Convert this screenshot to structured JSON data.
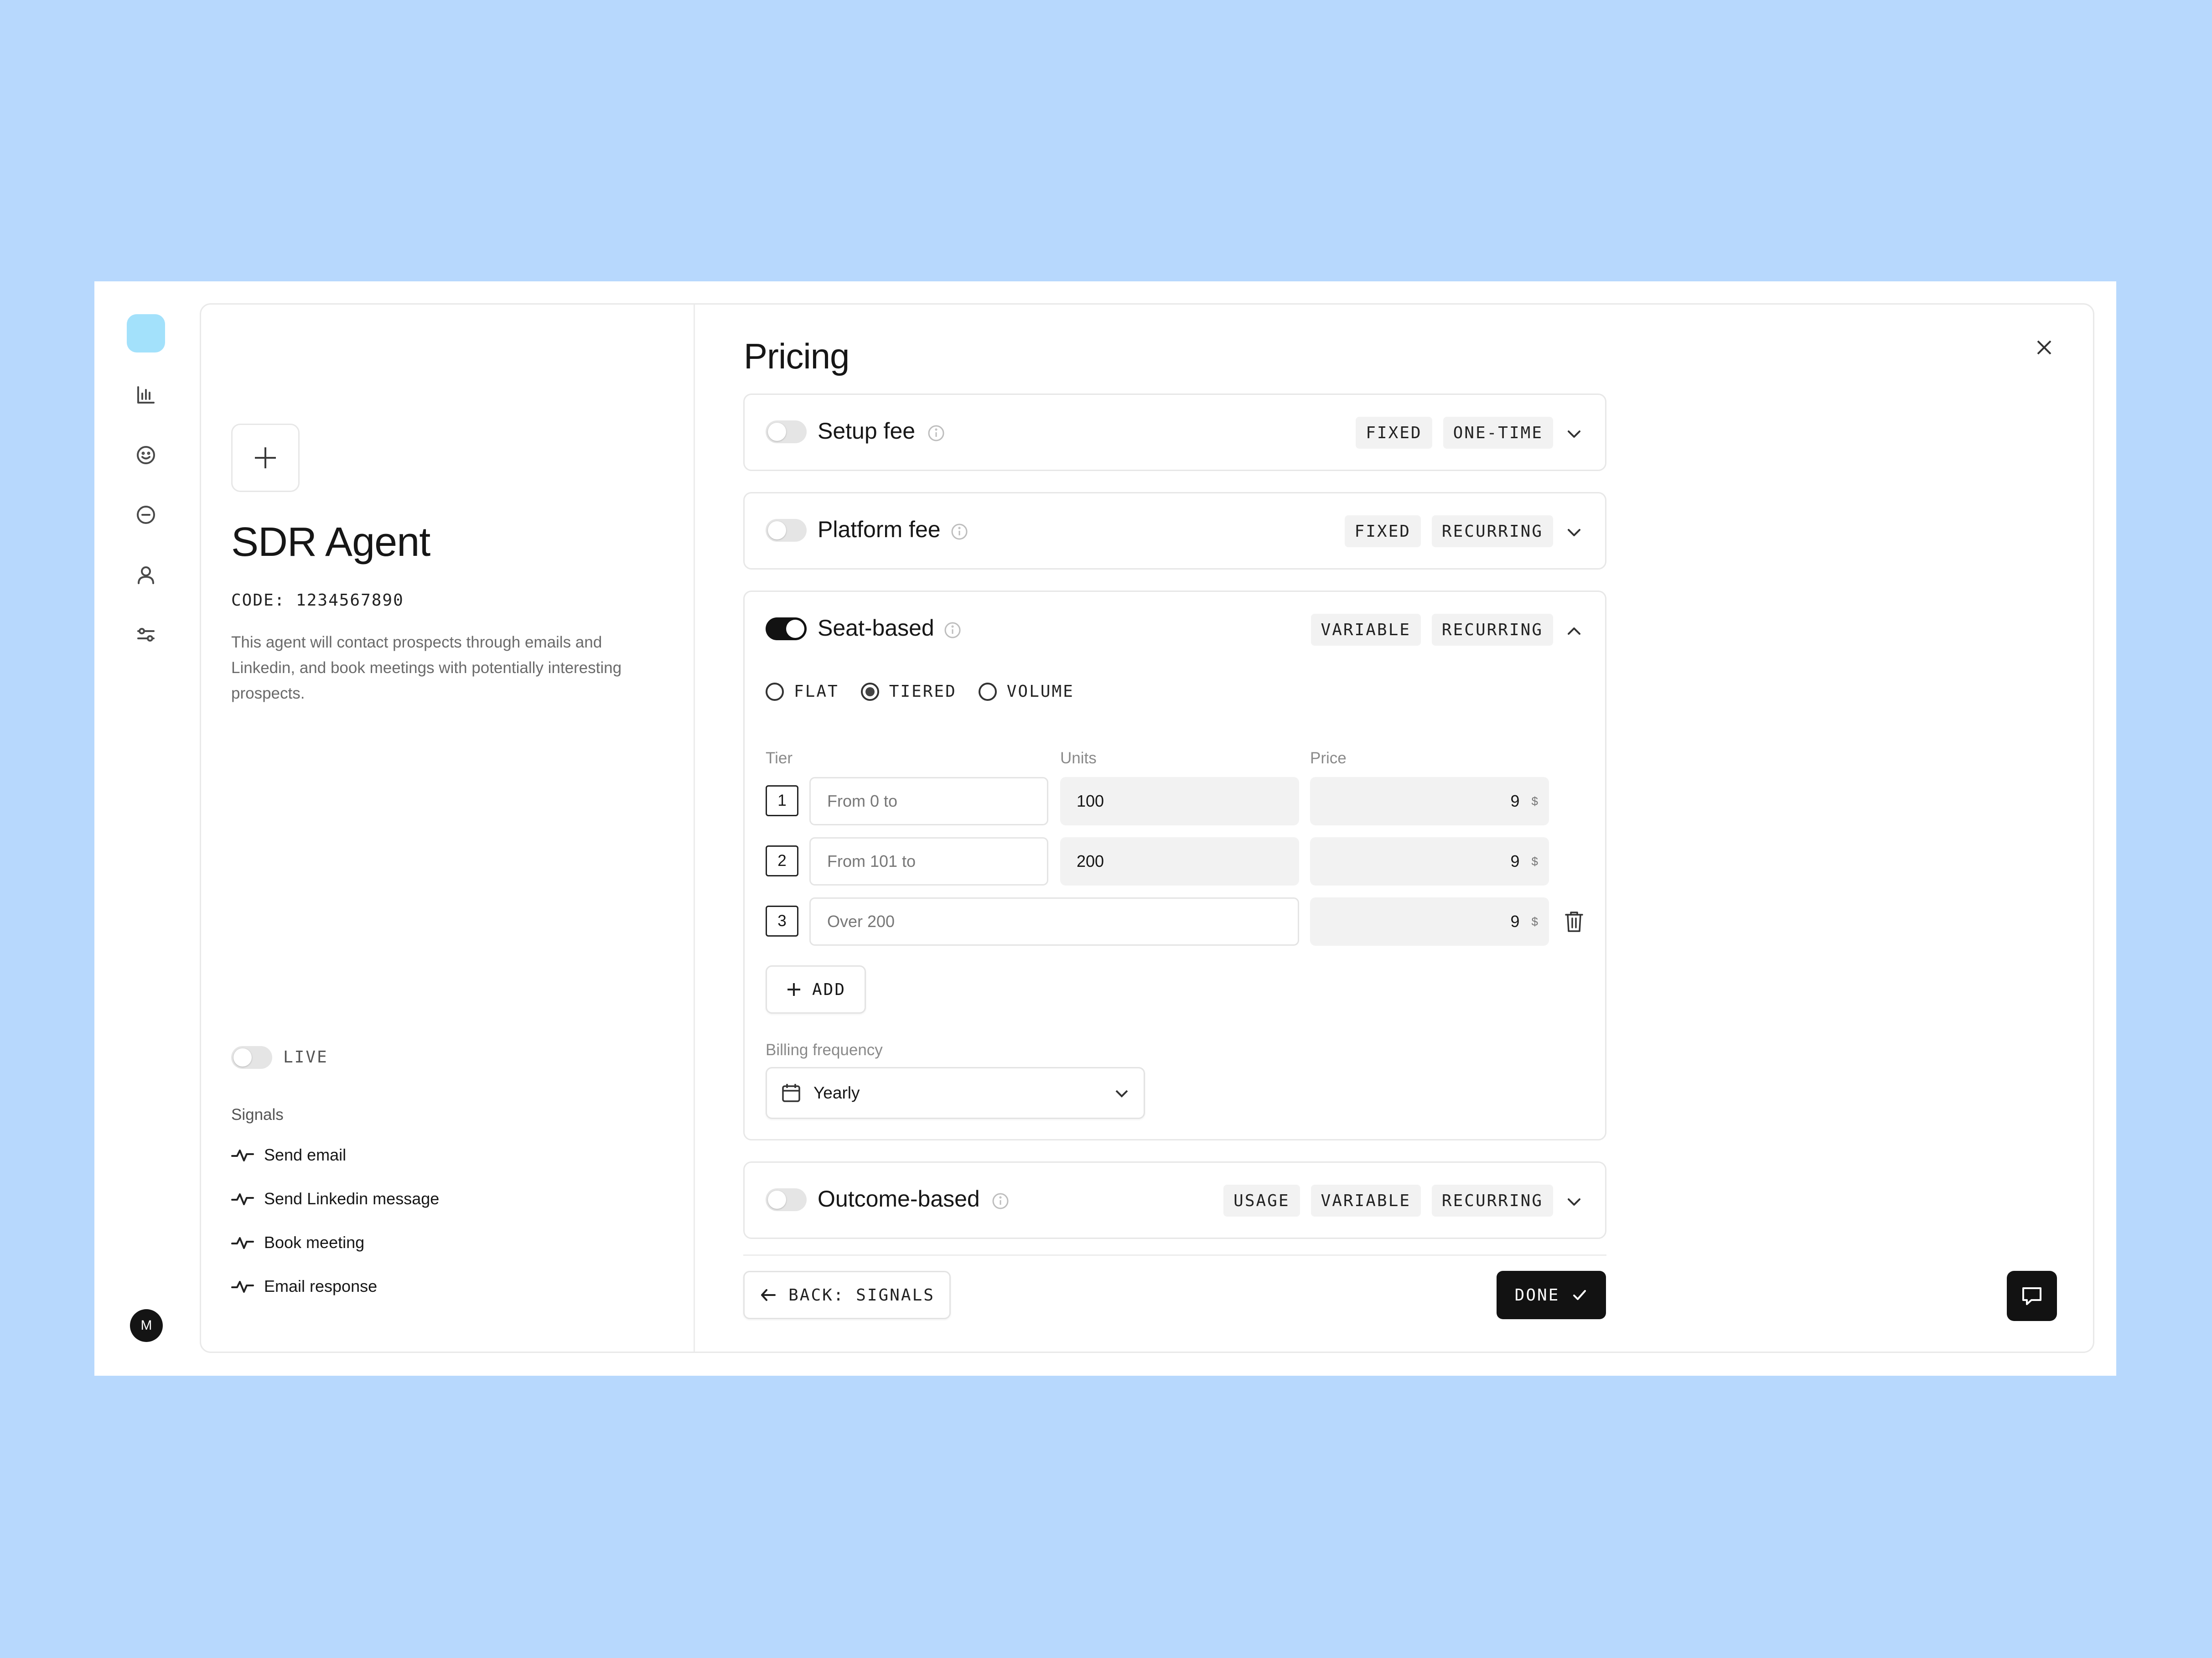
{
  "agent": {
    "title": "SDR Agent",
    "code": "CODE: 1234567890",
    "description": "This agent will contact prospects through emails and Linkedin, and book meetings with potentially interesting prospects.",
    "live_label": "LIVE",
    "live_on": false
  },
  "signals": {
    "title": "Signals",
    "items": [
      {
        "label": "Send email"
      },
      {
        "label": "Send Linkedin message"
      },
      {
        "label": "Book meeting"
      },
      {
        "label": "Email response"
      }
    ]
  },
  "sidebar": {
    "icons": [
      "chart-icon",
      "smiley-icon",
      "minus-circle-icon",
      "user-icon",
      "sliders-icon"
    ],
    "avatar_initial": "M"
  },
  "pricing": {
    "title": "Pricing",
    "sections": [
      {
        "name": "Setup fee",
        "enabled": false,
        "tags": [
          "FIXED",
          "ONE-TIME"
        ],
        "expanded": false
      },
      {
        "name": "Platform fee",
        "enabled": false,
        "tags": [
          "FIXED",
          "RECURRING"
        ],
        "expanded": false
      },
      {
        "name": "Seat-based",
        "enabled": true,
        "tags": [
          "VARIABLE",
          "RECURRING"
        ],
        "expanded": true
      },
      {
        "name": "Outcome-based",
        "enabled": false,
        "tags": [
          "USAGE",
          "VARIABLE",
          "RECURRING"
        ],
        "expanded": false
      }
    ],
    "seat_based": {
      "models": [
        "FLAT",
        "TIERED",
        "VOLUME"
      ],
      "selected_model": "TIERED",
      "columns": {
        "tier": "Tier",
        "units": "Units",
        "price": "Price"
      },
      "tiers": [
        {
          "num": "1",
          "from_placeholder": "From 0 to",
          "units": "100",
          "price": "9",
          "currency": "$"
        },
        {
          "num": "2",
          "from_placeholder": "From 101 to",
          "units": "200",
          "price": "9",
          "currency": "$"
        },
        {
          "num": "3",
          "from_placeholder": "Over 200",
          "units": "",
          "price": "9",
          "currency": "$"
        }
      ],
      "add_label": "ADD",
      "billing_label": "Billing frequency",
      "billing_value": "Yearly"
    }
  },
  "footer": {
    "back_label": "BACK: SIGNALS",
    "done_label": "DONE"
  },
  "colors": {
    "background": "#b7d8fd",
    "logo": "#a3e1fb",
    "primary": "#121212"
  }
}
